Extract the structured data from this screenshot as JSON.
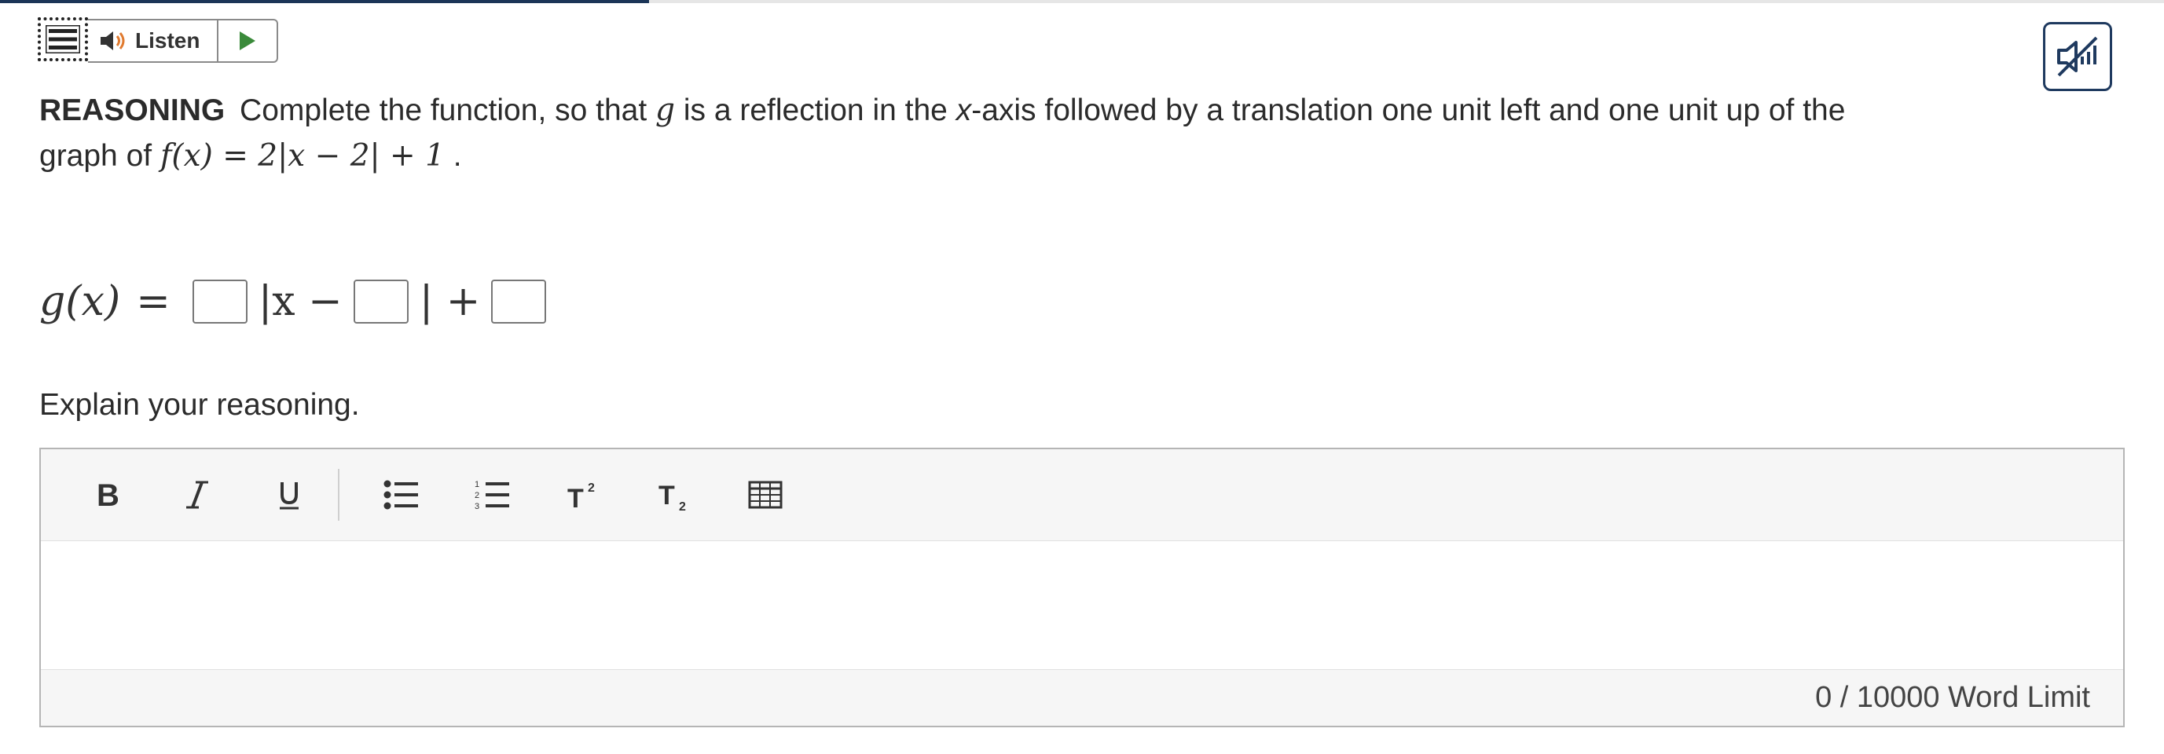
{
  "progress": {
    "fraction": 0.3
  },
  "top_toolbar": {
    "listen_label": "Listen"
  },
  "question": {
    "label": "REASONING",
    "line1_a": "Complete the function, so that",
    "var_g": "g",
    "line1_b": "is a reflection in the",
    "axis_var": "x",
    "line1_c": "-axis followed by a translation one unit left and one unit up of the",
    "line2_a": "graph of",
    "f_expr": "f(x) = 2|x − 2| + 1",
    "line2_end": "."
  },
  "equation": {
    "lhs": "g(x)",
    "eq": "=",
    "abs_open": "|x −",
    "abs_close": "| +",
    "blanks": [
      "",
      "",
      ""
    ]
  },
  "explain_prompt": "Explain your reasoning.",
  "editor": {
    "toolbar_icons": [
      "bold-icon",
      "italic-icon",
      "underline-icon",
      "bulleted-list-icon",
      "numbered-list-icon",
      "superscript-icon",
      "subscript-icon",
      "table-icon"
    ],
    "word_count": "0 / 10000 Word Limit"
  },
  "colors": {
    "accent_dark": "#1b3557",
    "play_green": "#3a8a3a",
    "speaker_orange": "#e07a2f"
  }
}
